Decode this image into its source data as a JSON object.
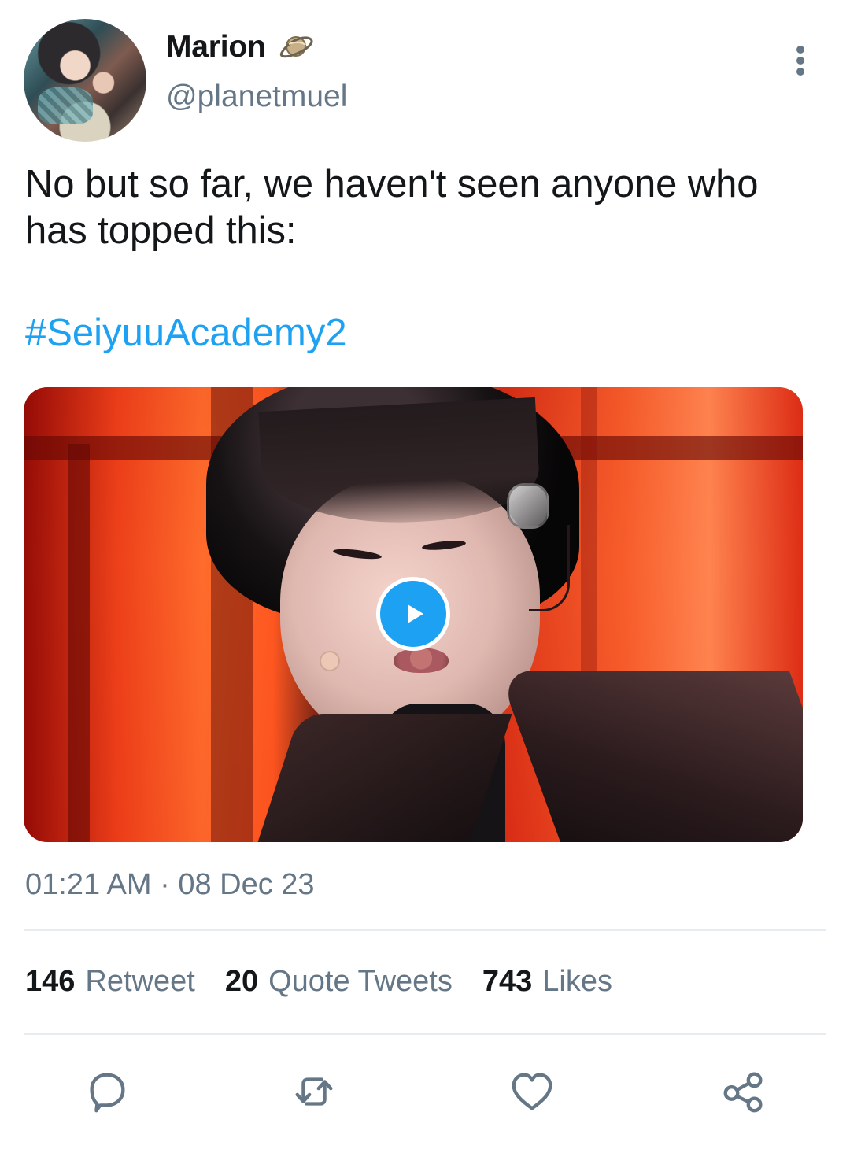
{
  "tweet": {
    "display_name": "Marion",
    "handle": "@planetmuel",
    "text": "No but so far, we haven't seen anyone who has topped this:",
    "hashtag": "#SeiyuuAcademy2",
    "timestamp": "01:21 AM · 08 Dec 23"
  },
  "stats": [
    {
      "count": "146",
      "label": "Retweet"
    },
    {
      "count": "20",
      "label": "Quote Tweets"
    },
    {
      "count": "743",
      "label": "Likes"
    }
  ],
  "icons": {
    "display_name_emoji": "ringed-planet-icon",
    "more": "more-vertical-icon",
    "media_play": "play-icon",
    "reply": "reply-icon",
    "retweet": "retweet-icon",
    "like": "heart-icon",
    "share": "share-icon"
  },
  "colors": {
    "text": "#14171a",
    "secondary_text": "#657786",
    "link": "#1da1f2",
    "play_button": "#1da1f2"
  }
}
